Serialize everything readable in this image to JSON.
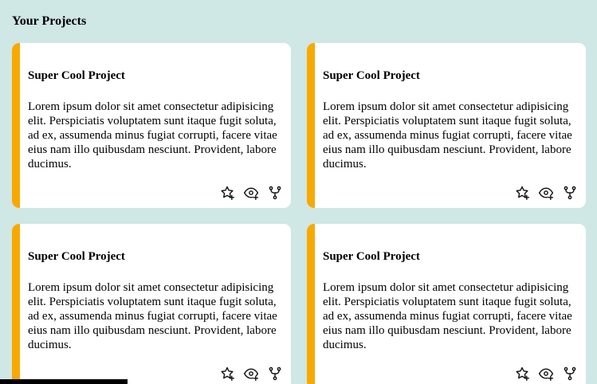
{
  "section": {
    "title": "Your Projects"
  },
  "colors": {
    "background": "#cfe7e5",
    "card": "#ffffff",
    "accent": "#f8a900"
  },
  "projects": [
    {
      "title": "Super Cool Project",
      "description": "Lorem ipsum dolor sit amet consectetur adipisicing elit. Perspiciatis voluptatem sunt itaque fugit soluta, ad ex, assumenda minus fugiat corrupti, facere vitae eius nam illo quibusdam nesciunt. Provident, labore ducimus.",
      "actions": [
        "star-plus-icon",
        "eye-plus-icon",
        "fork-icon"
      ]
    },
    {
      "title": "Super Cool Project",
      "description": "Lorem ipsum dolor sit amet consectetur adipisicing elit. Perspiciatis voluptatem sunt itaque fugit soluta, ad ex, assumenda minus fugiat corrupti, facere vitae eius nam illo quibusdam nesciunt. Provident, labore ducimus.",
      "actions": [
        "star-plus-icon",
        "eye-plus-icon",
        "fork-icon"
      ]
    },
    {
      "title": "Super Cool Project",
      "description": "Lorem ipsum dolor sit amet consectetur adipisicing elit. Perspiciatis voluptatem sunt itaque fugit soluta, ad ex, assumenda minus fugiat corrupti, facere vitae eius nam illo quibusdam nesciunt. Provident, labore ducimus.",
      "actions": [
        "star-plus-icon",
        "eye-plus-icon",
        "fork-icon"
      ]
    },
    {
      "title": "Super Cool Project",
      "description": "Lorem ipsum dolor sit amet consectetur adipisicing elit. Perspiciatis voluptatem sunt itaque fugit soluta, ad ex, assumenda minus fugiat corrupti, facere vitae eius nam illo quibusdam nesciunt. Provident, labore ducimus.",
      "actions": [
        "star-plus-icon",
        "eye-plus-icon",
        "fork-icon"
      ]
    }
  ]
}
